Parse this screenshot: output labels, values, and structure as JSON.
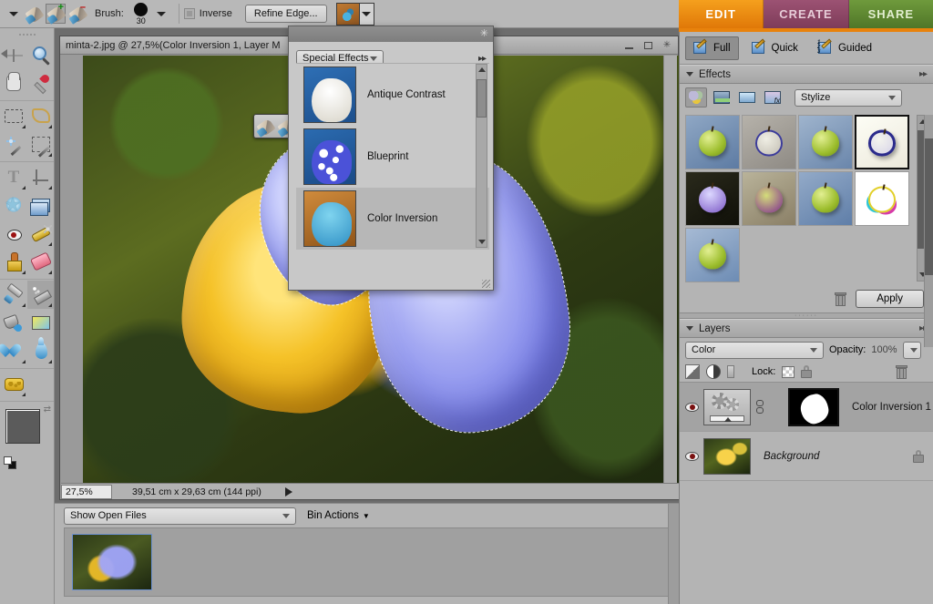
{
  "options_bar": {
    "brush_tools": [
      {
        "name": "selection-brush",
        "modifier": ""
      },
      {
        "name": "selection-brush-add",
        "modifier": "+"
      },
      {
        "name": "selection-brush-subtract",
        "modifier": "-"
      }
    ],
    "brush_label": "Brush:",
    "brush_size": "30",
    "inverse_label": "Inverse",
    "refine_edge_label": "Refine Edge...",
    "effect_swatch_name": "color-inversion-preview"
  },
  "mode_tabs": [
    {
      "label": "EDIT",
      "active": true,
      "color": "#e8820c"
    },
    {
      "label": "CREATE",
      "active": false,
      "color": "#7e3c59"
    },
    {
      "label": "SHARE",
      "active": false,
      "color": "#4f7628"
    }
  ],
  "edit_modes": [
    {
      "label": "Full",
      "active": true,
      "icon": "full-edit-icon"
    },
    {
      "label": "Quick",
      "active": false,
      "icon": "quick-edit-icon"
    },
    {
      "label": "Guided",
      "active": false,
      "icon": "guided-edit-icon"
    }
  ],
  "effects_panel": {
    "title": "Effects",
    "categories": [
      {
        "name": "filters-icon",
        "selected": true
      },
      {
        "name": "layer-styles-icon",
        "selected": false
      },
      {
        "name": "photo-effects-icon",
        "selected": false
      },
      {
        "name": "text-effects-icon",
        "selected": false
      }
    ],
    "category_dropdown": "Stylize",
    "thumbnails": [
      {
        "name": "diffuse",
        "selected": false
      },
      {
        "name": "emboss",
        "selected": false
      },
      {
        "name": "extrude",
        "selected": false
      },
      {
        "name": "find-edges",
        "selected": true
      },
      {
        "name": "glowing-edges",
        "selected": false
      },
      {
        "name": "solarize",
        "selected": false
      },
      {
        "name": "tiles",
        "selected": false
      },
      {
        "name": "trace-contour",
        "selected": false
      },
      {
        "name": "wind",
        "selected": false
      }
    ],
    "apply_label": "Apply",
    "delete_icon": "trash-icon"
  },
  "layers_panel": {
    "title": "Layers",
    "blend_mode": "Color",
    "opacity_label": "Opacity:",
    "opacity_value": "100%",
    "lock_label": "Lock:",
    "layers": [
      {
        "name": "Color Inversion 1",
        "selected": true,
        "visible": true,
        "type": "adjustment",
        "has_mask": true,
        "locked": false,
        "italic": false
      },
      {
        "name": "Background",
        "selected": false,
        "visible": true,
        "type": "image",
        "has_mask": false,
        "locked": true,
        "italic": true
      }
    ]
  },
  "document": {
    "title": "minta-2.jpg @ 27,5%(Color Inversion 1, Layer M",
    "zoom": "27,5%",
    "dimensions": "39,51 cm x 29,63 cm (144 ppi)",
    "window_buttons": [
      "minimize-button",
      "maximize-button",
      "close-button"
    ]
  },
  "photo_bin": {
    "filter_dropdown": "Show Open Files",
    "actions_label": "Bin Actions",
    "thumbnails": [
      {
        "name": "minta-2-thumbnail",
        "selected": true
      }
    ]
  },
  "effects_dialog": {
    "close_icon": "close-icon",
    "category": "Special Effects",
    "items": [
      {
        "label": "Antique Contrast",
        "selected": false,
        "thumb": "dog-antique-contrast"
      },
      {
        "label": "Blueprint",
        "selected": false,
        "thumb": "dog-blueprint"
      },
      {
        "label": "Color Inversion",
        "selected": true,
        "thumb": "dog-color-inversion"
      }
    ]
  },
  "toolbox": {
    "tools": [
      {
        "name": "move-tool",
        "row": 0,
        "col": 0
      },
      {
        "name": "zoom-tool",
        "row": 0,
        "col": 1
      },
      {
        "name": "hand-tool",
        "row": 1,
        "col": 0
      },
      {
        "name": "eyedropper-tool",
        "row": 1,
        "col": 1
      },
      {
        "name": "marquee-tool",
        "row": 2,
        "col": 0
      },
      {
        "name": "lasso-tool",
        "row": 2,
        "col": 1
      },
      {
        "name": "magic-wand-tool",
        "row": 3,
        "col": 0
      },
      {
        "name": "quick-selection-tool",
        "row": 3,
        "col": 1
      },
      {
        "name": "type-tool",
        "row": 4,
        "col": 0
      },
      {
        "name": "crop-tool",
        "row": 4,
        "col": 1
      },
      {
        "name": "cookie-cutter-tool",
        "row": 5,
        "col": 0
      },
      {
        "name": "shape-tool",
        "row": 5,
        "col": 1
      },
      {
        "name": "red-eye-removal-tool",
        "row": 6,
        "col": 0
      },
      {
        "name": "healing-brush-tool",
        "row": 6,
        "col": 1
      },
      {
        "name": "clone-stamp-tool",
        "row": 7,
        "col": 0
      },
      {
        "name": "eraser-tool",
        "row": 7,
        "col": 1
      },
      {
        "name": "brush-tool",
        "row": 8,
        "col": 0
      },
      {
        "name": "smart-brush-tool",
        "row": 8,
        "col": 1
      },
      {
        "name": "paint-bucket-tool",
        "row": 9,
        "col": 0
      },
      {
        "name": "gradient-tool",
        "row": 9,
        "col": 1
      },
      {
        "name": "blur-tool",
        "row": 10,
        "col": 0
      },
      {
        "name": "sharpen-tool",
        "row": 10,
        "col": 1
      },
      {
        "name": "sponge-tool",
        "row": 11,
        "col": 0
      }
    ],
    "foreground_color": "#5b5b5b",
    "background_color": "#000000"
  }
}
